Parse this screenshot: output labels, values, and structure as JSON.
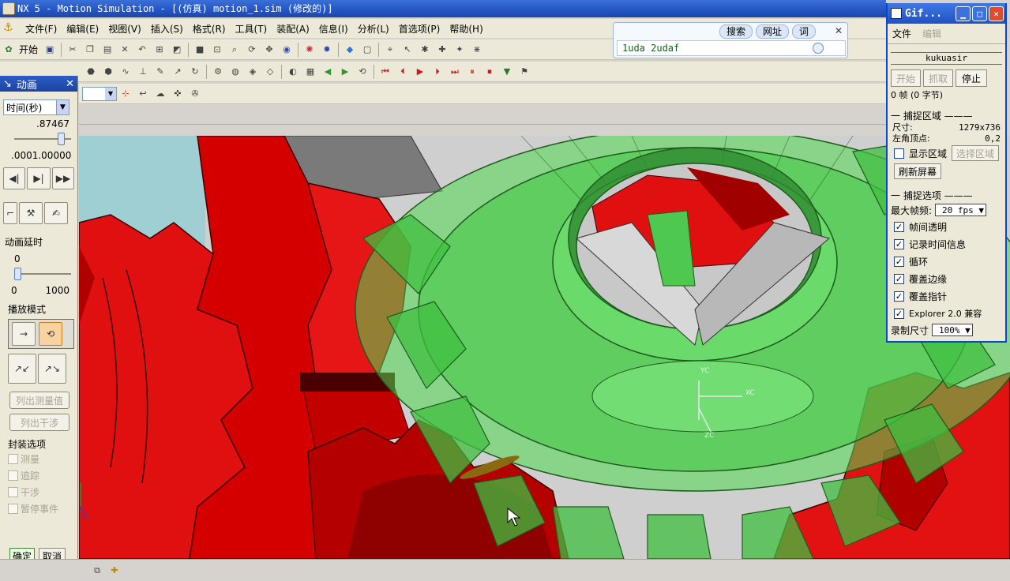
{
  "window": {
    "title": "NX 5 - Motion Simulation - [(仿真) motion_1.sim (修改的)]"
  },
  "menubar": {
    "items": [
      "文件(F)",
      "编辑(E)",
      "视图(V)",
      "插入(S)",
      "格式(R)",
      "工具(T)",
      "装配(A)",
      "信息(I)",
      "分析(L)",
      "首选项(P)",
      "帮助(H)"
    ]
  },
  "toolbar": {
    "start_label": "开始"
  },
  "searchbar": {
    "tabs": [
      "搜索",
      "网址",
      "词"
    ],
    "input_value": "1uda 2udaf"
  },
  "animpanel": {
    "title": "动画",
    "time_select": "时间(秒)",
    "time_value": ".87467",
    "time_slider_fraction": 0.87467,
    "range_min": ".000",
    "range_max": "1.00000",
    "delay_label": "动画延时",
    "delay_value": "0",
    "delay_slider_fraction": 0.0,
    "delay_min": "0",
    "delay_max": "1000",
    "play_mode_label": "播放模式",
    "list_measure": "列出测量值",
    "list_interference": "列出干涉",
    "package_label": "封装选项",
    "packaging": [
      "测量",
      "追踪",
      "干涉",
      "暂停事件"
    ],
    "ok": "确定",
    "cancel": "取消"
  },
  "gifwin": {
    "title": "Gif...",
    "menu": [
      "文件",
      "编辑"
    ],
    "user": "kukuasir",
    "buttons": {
      "start": "开始",
      "capture": "抓取",
      "stop": "停止"
    },
    "frames": "0 帧 (0 字节)",
    "capture_area_label": "捕捉区域",
    "size_label": "尺寸:",
    "size_value": "1279x736",
    "corner_label": "左角顶点:",
    "corner_value": "0,2",
    "show_area": "显示区域",
    "select_area": "选择区域",
    "refresh": "刷新屏幕",
    "options_label": "捕捉选项",
    "max_fps_label": "最大帧频:",
    "max_fps_value": "20 fps",
    "options": [
      "帧间透明",
      "记录时间信息",
      "循环",
      "覆盖边缘",
      "覆盖指针",
      "Explorer 2.0 兼容"
    ],
    "rec_size_label": "录制尺寸",
    "rec_size_value": "100%"
  },
  "viewport": {
    "axis_labels": {
      "yc": "YC",
      "xc": "XC",
      "zc": "ZC"
    }
  }
}
